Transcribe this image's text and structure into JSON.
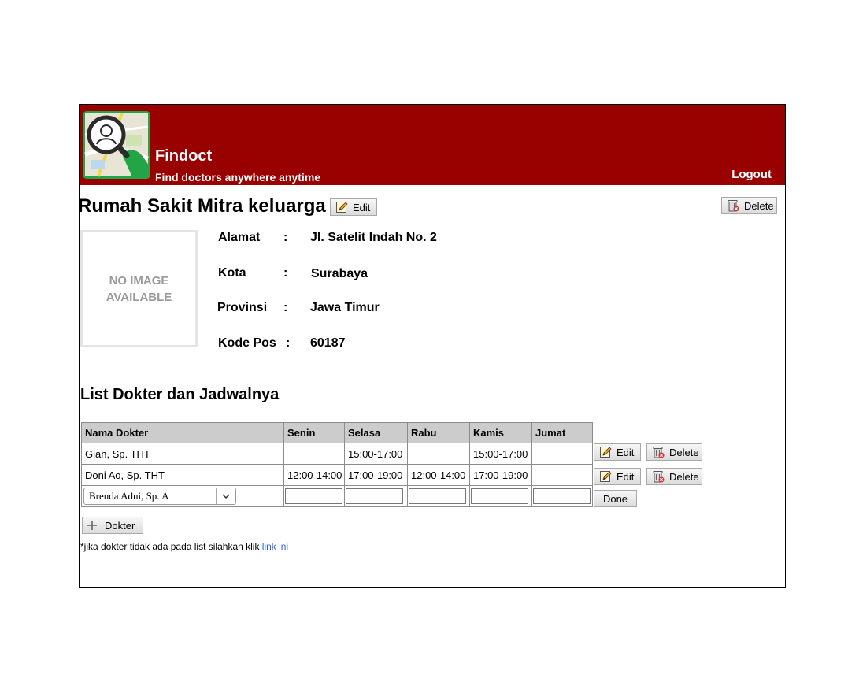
{
  "header": {
    "brand": "Findoct",
    "tagline": "Find doctors anywhere anytime",
    "logout": "Logout",
    "bg_color": "#990000"
  },
  "hospital": {
    "name": "Rumah Sakit Mitra keluarga",
    "edit_label": "Edit",
    "delete_label": "Delete",
    "no_image_line1": "NO IMAGE",
    "no_image_line2": "AVAILABLE",
    "fields": [
      {
        "label": "Alamat",
        "colon": ":",
        "value": "Jl. Satelit Indah No. 2"
      },
      {
        "label": "Kota",
        "colon": ":",
        "value": "Surabaya"
      },
      {
        "label": "Provinsi",
        "colon": ":",
        "value": "Jawa Timur"
      },
      {
        "label": "Kode Pos",
        "colon": ":",
        "value": "60187"
      }
    ]
  },
  "doctors": {
    "title": "List Dokter dan Jadwalnya",
    "columns": [
      "Nama Dokter",
      "Senin",
      "Selasa",
      "Rabu",
      "Kamis",
      "Jumat"
    ],
    "rows": [
      {
        "name": "Gian, Sp. THT",
        "senin": "",
        "selasa": "15:00-17:00",
        "rabu": "",
        "kamis": "15:00-17:00",
        "jumat": ""
      },
      {
        "name": "Doni Ao, Sp. THT",
        "senin": "12:00-14:00",
        "selasa": "17:00-19:00",
        "rabu": "12:00-14:00",
        "kamis": "17:00-19:00",
        "jumat": ""
      }
    ],
    "new_row": {
      "selected_doctor": "Brenda Adni, Sp. A",
      "senin": "",
      "selasa": "",
      "rabu": "",
      "kamis": "",
      "jumat": ""
    },
    "edit_label": "Edit",
    "delete_label": "Delete",
    "done_label": "Done",
    "add_label": "Dokter",
    "note_text": "*jika dokter tidak ada pada list silahkan klik ",
    "note_link": "link ini"
  },
  "icons": {
    "logo": "findoct-logo-icon",
    "edit": "pencil-edit-icon",
    "delete": "trash-delete-icon",
    "add": "plus-icon",
    "dropdown": "chevron-down-icon"
  }
}
